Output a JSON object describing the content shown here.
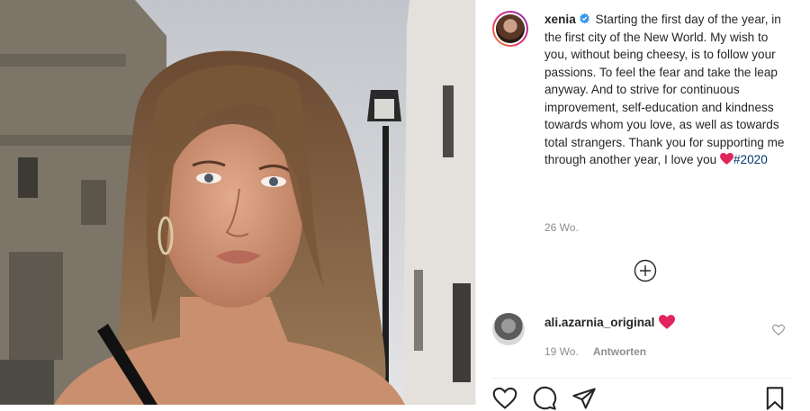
{
  "post": {
    "username": "xenia",
    "caption": "Starting the first day of the year, in the first city of the New World. My wish to you, without being cheesy, is to follow your passions. To feel the fear and take the leap anyway. And to strive for continuous improvement, self-education and kindness towards whom you love, as well as towards total strangers. Thank you for supporting me through another year, I love you",
    "hashtag": "#2020",
    "time": "26 Wo."
  },
  "comment": {
    "username": "ali.azarnia_original",
    "time": "19 Wo.",
    "reply_label": "Antworten"
  },
  "colors": {
    "verified": "#3897f0",
    "heart": "#ed4956",
    "link": "#00376b",
    "muted": "#8e8e8e"
  },
  "icons": [
    "verified-badge-icon",
    "heart-emoji-icon",
    "add-circle-icon",
    "like-icon",
    "comment-icon",
    "share-icon",
    "save-icon"
  ]
}
